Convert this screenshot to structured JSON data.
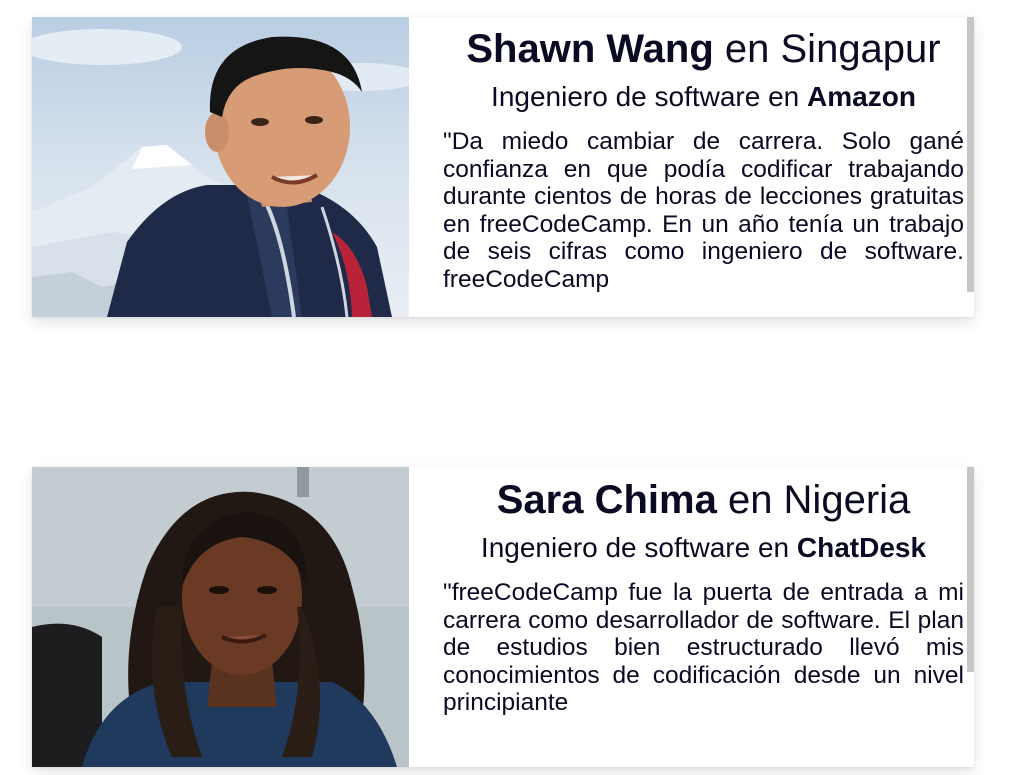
{
  "testimonials": [
    {
      "name": "Shawn Wang",
      "location_text": " en Singapur",
      "role_prefix": "Ingeniero de software en ",
      "company": "Amazon",
      "quote": "\"Da miedo cambiar de carrera. Solo gané confianza en que podía codificar trabajando durante cientos de horas de lecciones gratuitas en freeCodeCamp. En un año tenía un trabajo de seis cifras como ingeniero de software. freeCodeCamp"
    },
    {
      "name": "Sara Chima",
      "location_text": " en Nigeria",
      "role_prefix": "Ingeniero de software en ",
      "company": "ChatDesk",
      "quote": "\"freeCodeCamp fue la puerta de entrada a mi carrera como desarrollador de software. El plan de estudios bien estructurado llevó mis conocimientos de codificación desde un nivel principiante"
    }
  ],
  "icons": {
    "photo1": "photo-shawn-wang",
    "photo2": "photo-sara-chima"
  }
}
